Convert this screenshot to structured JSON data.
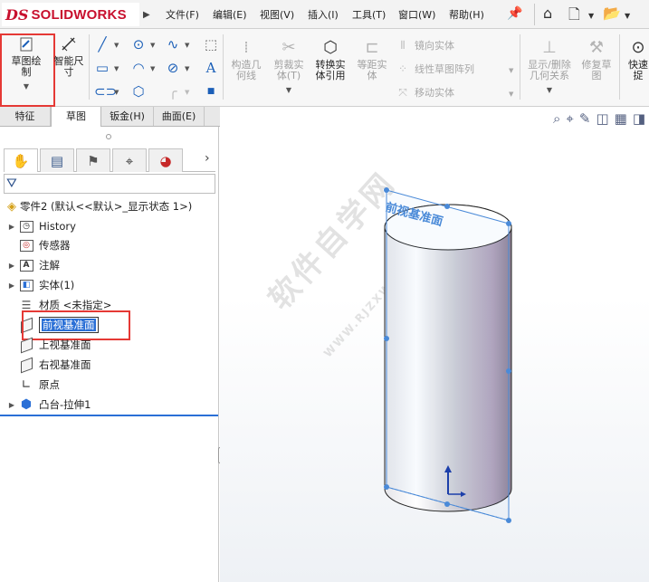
{
  "app": {
    "logo_prefix": "DS",
    "logo_name": "SOLIDWORKS"
  },
  "menu": {
    "items": [
      "文件(F)",
      "编辑(E)",
      "视图(V)",
      "插入(I)",
      "工具(T)",
      "窗口(W)",
      "帮助(H)"
    ]
  },
  "ribbon": {
    "sketch_label": "草图绘\n制",
    "smart_dim_label": "智能尺\n寸",
    "construct_label": "构造几\n何线",
    "trim_label": "剪裁实\n体(T)",
    "convert_label": "转换实\n体引用",
    "offset_label": "等距实\n体",
    "mirror_label": "镜向实体",
    "linear_pattern_label": "线性草图阵列",
    "move_label": "移动实体",
    "show_delete_label": "显示/删除\n几何关系",
    "repair_label": "修复草\n图",
    "quick_snap_label": "快速\n捉"
  },
  "tabs": [
    "特征",
    "草图",
    "钣金(H)",
    "曲面(E)"
  ],
  "tree": {
    "root": "零件2 (默认<<默认>_显示状态 1>)",
    "history": "History",
    "sensors": "传感器",
    "annotations": "注解",
    "solid_bodies": "实体(1)",
    "material": "材质 <未指定>",
    "front_plane_edit": "前视基准面",
    "top_plane": "上视基准面",
    "right_plane": "右视基准面",
    "origin": "原点",
    "boss_extrude": "凸台-拉伸1"
  },
  "viewport": {
    "plane_label": "前视基准面",
    "watermark": "软件自学网",
    "watermark_url": "WWW.RJZXW.COM"
  }
}
